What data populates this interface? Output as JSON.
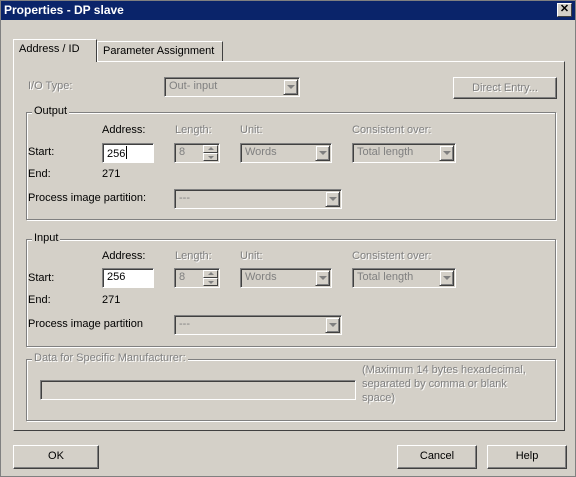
{
  "window": {
    "title": "Properties - DP slave",
    "close_glyph": "✕"
  },
  "tabs": [
    {
      "label": "Address / ID",
      "active": true
    },
    {
      "label": "Parameter Assignment",
      "active": false
    }
  ],
  "io_type": {
    "label": "I/O Type:",
    "value": "Out- input",
    "direct_entry_button": "Direct Entry..."
  },
  "output": {
    "group_label": "Output",
    "address_header": "Address:",
    "length_header": "Length:",
    "unit_header": "Unit:",
    "consistent_header": "Consistent over:",
    "start_label": "Start:",
    "start_value": "256",
    "length_value": "8",
    "unit_value": "Words",
    "consistent_value": "Total length",
    "end_label": "End:",
    "end_value": "271",
    "partition_label": "Process image partition:",
    "partition_value": "---"
  },
  "input": {
    "group_label": "Input",
    "address_header": "Address:",
    "length_header": "Length:",
    "unit_header": "Unit:",
    "consistent_header": "Consistent over:",
    "start_label": "Start:",
    "start_value": "256",
    "length_value": "8",
    "unit_value": "Words",
    "consistent_value": "Total length",
    "end_label": "End:",
    "end_value": "271",
    "partition_label": "Process image partition",
    "partition_value": "---"
  },
  "manufacturer": {
    "group_label": "Data for Specific Manufacturer:",
    "value": "",
    "hint_line1": "(Maximum 14 bytes hexadecimal,",
    "hint_line2": "separated by comma or blank",
    "hint_line3": "space)"
  },
  "footer": {
    "ok_label": "OK",
    "cancel_label": "Cancel",
    "help_label": "Help"
  },
  "colors": {
    "titlebar": "#0a246a",
    "dialog": "#d4d0c8",
    "disabled_text": "#808080"
  }
}
